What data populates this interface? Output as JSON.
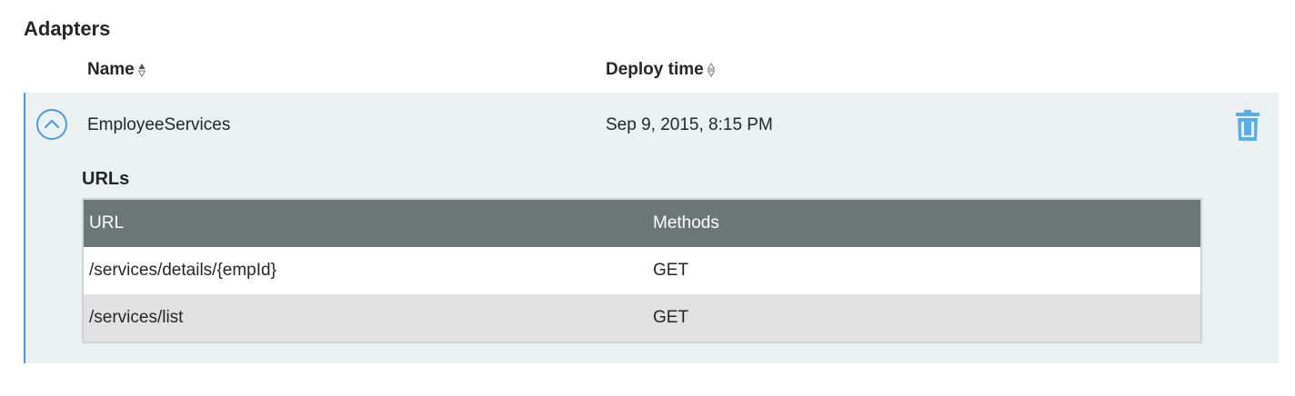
{
  "page": {
    "title": "Adapters"
  },
  "columns": {
    "name": "Name",
    "deploy_time": "Deploy time"
  },
  "adapter": {
    "name": "EmployeeServices",
    "deploy_time": "Sep 9, 2015, 8:15 PM",
    "expanded": true
  },
  "urls": {
    "title": "URLs",
    "headers": {
      "url": "URL",
      "methods": "Methods"
    },
    "rows": [
      {
        "url": "/services/details/{empId}",
        "methods": "GET"
      },
      {
        "url": "/services/list",
        "methods": "GET"
      }
    ]
  },
  "colors": {
    "accent": "#4b9be3",
    "row_background": "#ebf0f0",
    "table_header": "#6d7676",
    "alt_row": "#e1e1e1"
  },
  "icons": {
    "sort": "sort-updown-icon",
    "collapse": "chevron-up-circle-icon",
    "delete": "trash-icon"
  }
}
